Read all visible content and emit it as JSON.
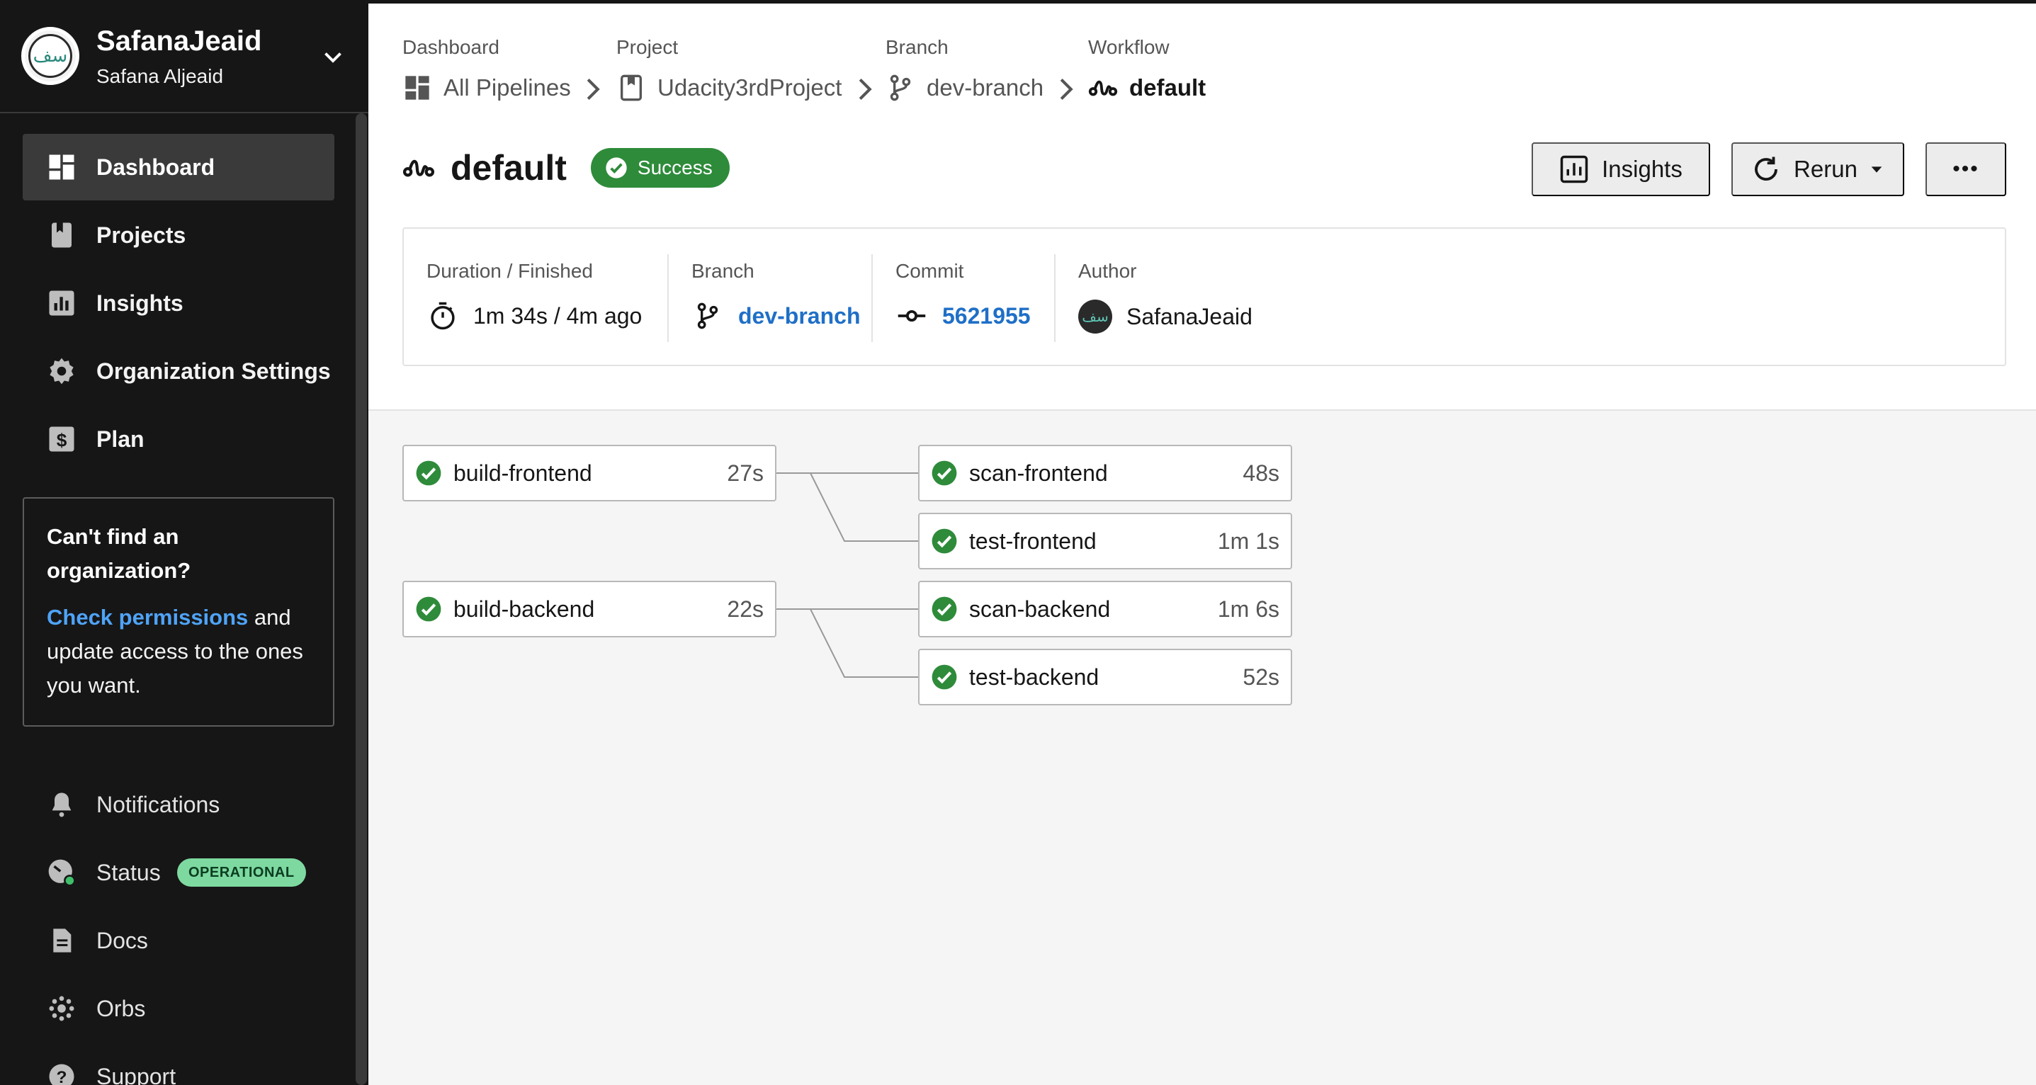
{
  "sidebar": {
    "org_name": "SafanaJeaid",
    "org_user": "Safana Aljeaid",
    "nav": [
      {
        "label": "Dashboard",
        "icon": "dashboard-icon",
        "active": true
      },
      {
        "label": "Projects",
        "icon": "bookmark-icon"
      },
      {
        "label": "Insights",
        "icon": "bar-chart-icon"
      },
      {
        "label": "Organization Settings",
        "icon": "gear-icon"
      },
      {
        "label": "Plan",
        "icon": "dollar-icon"
      }
    ],
    "promo": {
      "title": "Can't find an organization?",
      "link": "Check permissions",
      "body_rest": " and update access to the ones you want."
    },
    "footer": [
      {
        "label": "Notifications",
        "icon": "bell-icon"
      },
      {
        "label": "Status",
        "icon": "status-gauge-icon",
        "badge": "OPERATIONAL"
      },
      {
        "label": "Docs",
        "icon": "document-icon"
      },
      {
        "label": "Orbs",
        "icon": "orbs-icon"
      },
      {
        "label": "Support",
        "icon": "help-icon"
      }
    ]
  },
  "breadcrumb": [
    {
      "label": "Dashboard",
      "value": "All Pipelines",
      "icon": "pipelines-grid-icon"
    },
    {
      "label": "Project",
      "value": "Udacity3rdProject",
      "icon": "project-bookmark-icon"
    },
    {
      "label": "Branch",
      "value": "dev-branch",
      "icon": "branch-icon"
    },
    {
      "label": "Workflow",
      "value": "default",
      "icon": "workflow-icon"
    }
  ],
  "workflow": {
    "title": "default",
    "status": "Success",
    "status_color": "#2e8b3a"
  },
  "buttons": {
    "insights": "Insights",
    "rerun": "Rerun",
    "more": "•••"
  },
  "meta": {
    "duration_label": "Duration / Finished",
    "duration_value": "1m 34s / 4m ago",
    "branch_label": "Branch",
    "branch_value": "dev-branch",
    "commit_label": "Commit",
    "commit_value": "5621955",
    "author_label": "Author",
    "author_value": "SafanaJeaid"
  },
  "jobs": [
    {
      "name": "build-frontend",
      "duration": "27s",
      "status": "success"
    },
    {
      "name": "scan-frontend",
      "duration": "48s",
      "status": "success"
    },
    {
      "name": "test-frontend",
      "duration": "1m 1s",
      "status": "success"
    },
    {
      "name": "build-backend",
      "duration": "22s",
      "status": "success"
    },
    {
      "name": "scan-backend",
      "duration": "1m 6s",
      "status": "success"
    },
    {
      "name": "test-backend",
      "duration": "52s",
      "status": "success"
    }
  ],
  "colors": {
    "sidebar_bg": "#161616",
    "link": "#1f6fc7",
    "success": "#2e8b3a",
    "operational_badge": "#7ed9a0"
  }
}
